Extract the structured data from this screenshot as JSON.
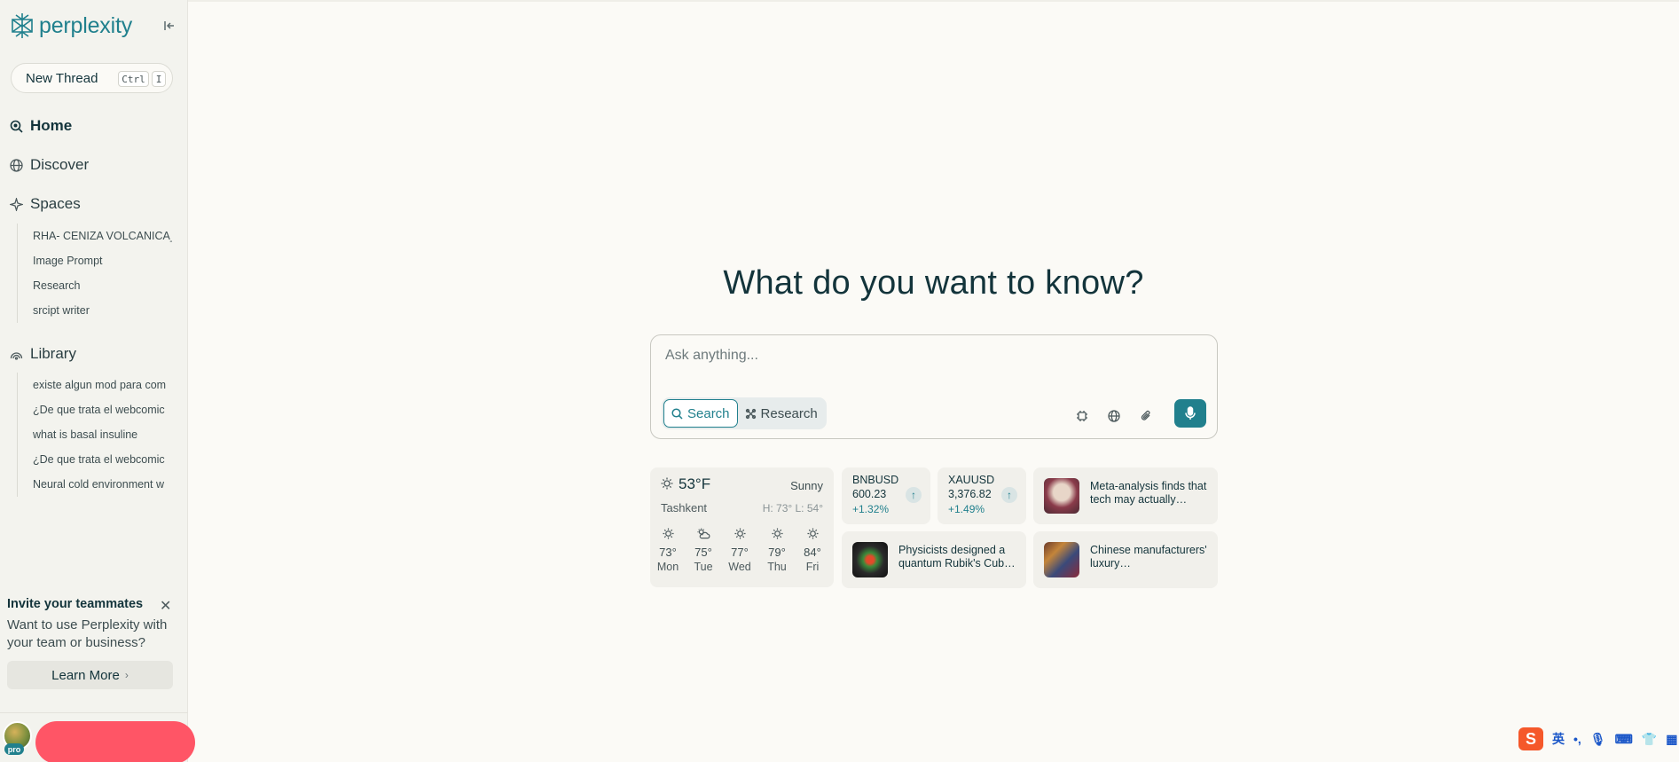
{
  "app": {
    "logo_text": "perplexity",
    "brand_color": "#20808d"
  },
  "sidebar": {
    "new_thread": {
      "label": "New Thread",
      "shortcut_ctrl": "Ctrl",
      "shortcut_key": "I"
    },
    "nav": [
      {
        "label": "Home",
        "icon": "home-search-icon",
        "active": true
      },
      {
        "label": "Discover",
        "icon": "globe-icon"
      },
      {
        "label": "Spaces",
        "icon": "spaces-icon"
      },
      {
        "label": "Library",
        "icon": "library-icon"
      }
    ],
    "spaces": [
      "RHA- CENIZA VOLCANICA_",
      "Image Prompt",
      "Research",
      "srcipt writer"
    ],
    "library": [
      "existe algun mod para com",
      "¿De que trata el webcomic",
      "what is basal insuline",
      "¿De que trata el webcomic",
      "Neural cold environment w"
    ],
    "invite": {
      "title": "Invite your teammates",
      "description": "Want to use Perplexity with your team or business?",
      "button": "Learn More"
    },
    "user": {
      "badge": "pro"
    }
  },
  "main": {
    "headline": "What do you want to know?",
    "search": {
      "placeholder": "Ask anything...",
      "modes": [
        "Search",
        "Research"
      ]
    },
    "weather": {
      "temp": "53°F",
      "condition": "Sunny",
      "city": "Tashkent",
      "high_low": "H: 73° L: 54°",
      "forecast": [
        {
          "temp": "73°",
          "day": "Mon",
          "icon": "sun-icon"
        },
        {
          "temp": "75°",
          "day": "Tue",
          "icon": "partly-cloudy-icon"
        },
        {
          "temp": "77°",
          "day": "Wed",
          "icon": "sun-icon"
        },
        {
          "temp": "79°",
          "day": "Thu",
          "icon": "sun-icon"
        },
        {
          "temp": "84°",
          "day": "Fri",
          "icon": "sun-icon"
        }
      ]
    },
    "tickers": [
      {
        "symbol": "BNBUSD",
        "price": "600.23",
        "change": "+1.32%"
      },
      {
        "symbol": "XAUUSD",
        "price": "3,376.82",
        "change": "+1.49%"
      }
    ],
    "news": [
      {
        "text": "Meta-analysis finds that tech may actually…"
      },
      {
        "text": "Physicists designed a quantum Rubik's Cub…"
      },
      {
        "text": "Chinese manufacturers' luxury…"
      }
    ]
  },
  "ime_toolbar": {
    "logo": "S",
    "lang": "英",
    "punct": "•,"
  }
}
